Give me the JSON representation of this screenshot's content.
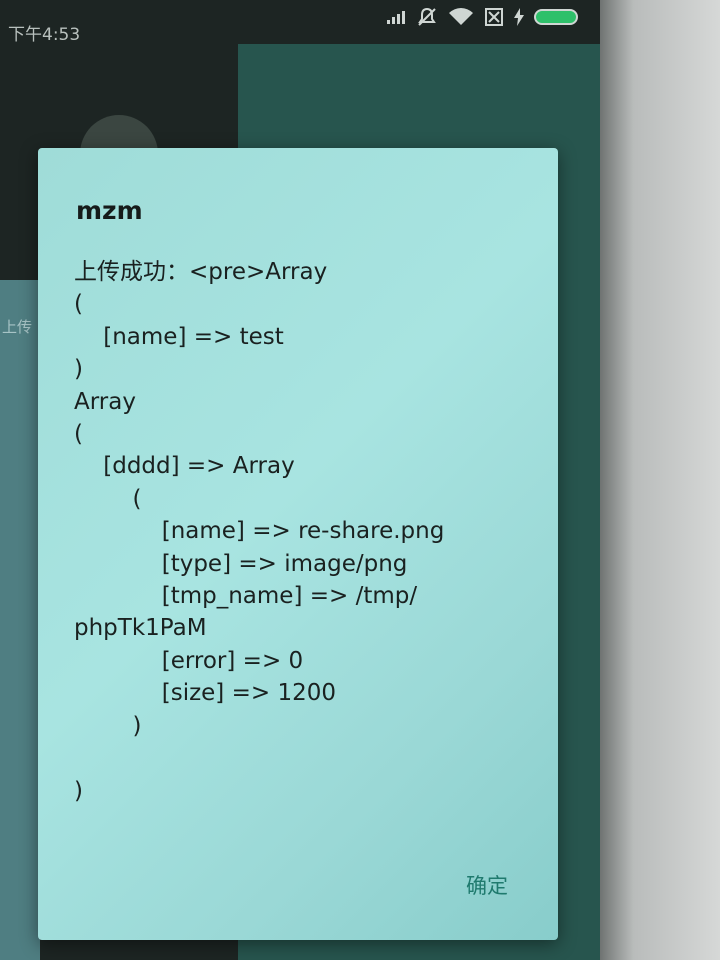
{
  "status_bar": {
    "time": "下午4:53",
    "icons": [
      "signal-icon",
      "silent-icon",
      "wifi-icon",
      "sim-icon",
      "charging-icon",
      "battery-icon"
    ],
    "battery_color": "#2ec06a"
  },
  "background": {
    "partial_text": "上传"
  },
  "dialog": {
    "title": "mzm",
    "message": "上传成功：<pre>Array\n(\n    [name] => test\n)\nArray\n(\n    [dddd] => Array\n        (\n            [name] => re-share.png\n            [type] => image/png\n            [tmp_name] => /tmp/\nphpTk1PaM\n            [error] => 0\n            [size] => 1200\n        )\n\n)",
    "button_label": "确定",
    "accent_color": "#1f7a6e"
  }
}
